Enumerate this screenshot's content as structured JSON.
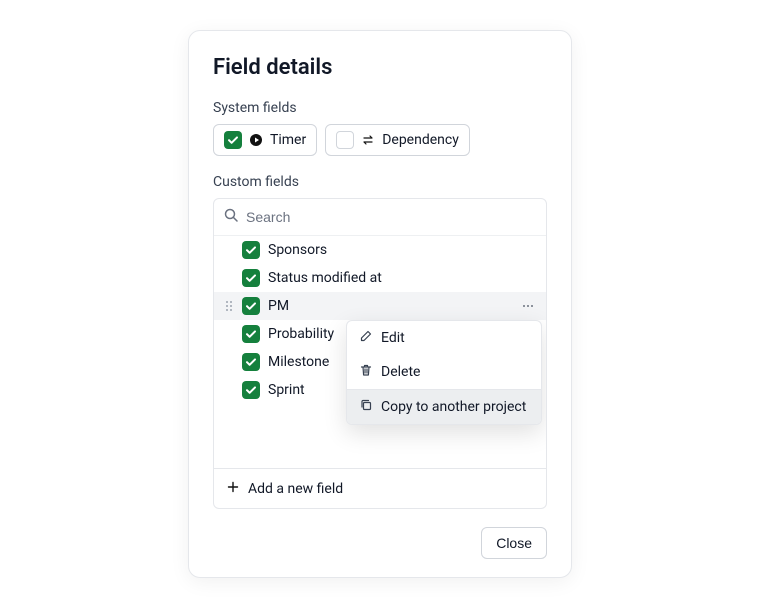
{
  "title": "Field details",
  "system": {
    "label": "System fields",
    "timer": {
      "checked": true,
      "label": "Timer"
    },
    "dependency": {
      "checked": false,
      "label": "Dependency"
    }
  },
  "custom": {
    "label": "Custom fields",
    "search_placeholder": "Search",
    "items": [
      {
        "label": "Sponsors",
        "checked": true
      },
      {
        "label": "Status modified at",
        "checked": true
      },
      {
        "label": "PM",
        "checked": true,
        "active": true
      },
      {
        "label": "Probability",
        "checked": true
      },
      {
        "label": "Milestone",
        "checked": true
      },
      {
        "label": "Sprint",
        "checked": true
      }
    ],
    "add_label": "Add a new field"
  },
  "menu": {
    "edit": "Edit",
    "delete": "Delete",
    "copy": "Copy to another project"
  },
  "close": "Close"
}
